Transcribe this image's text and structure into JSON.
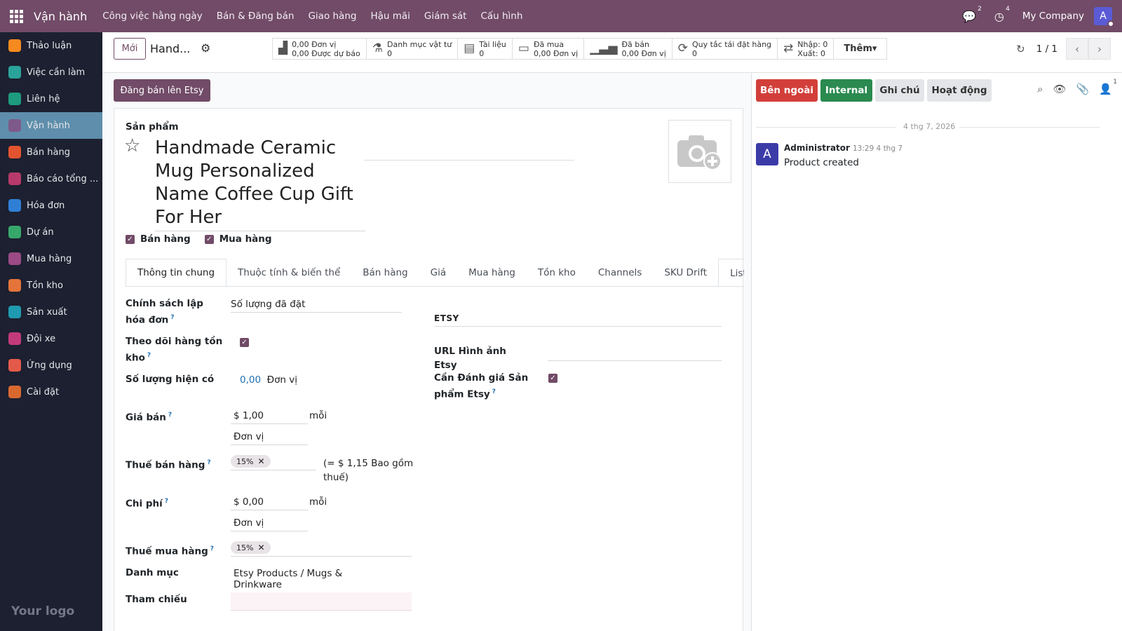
{
  "topnav": {
    "brand": "Vận hành",
    "menu": [
      "Công việc hằng ngày",
      "Bán & Đăng bán",
      "Giao hàng",
      "Hậu mãi",
      "Giám sát",
      "Cấu hình"
    ],
    "chat_count": "2",
    "activity_count": "4",
    "company": "My Company",
    "avatar_letter": "A"
  },
  "sidebar": {
    "items": [
      {
        "label": "Thảo luận",
        "color": "#f58a1f"
      },
      {
        "label": "Việc cần làm",
        "color": "#2aa39a"
      },
      {
        "label": "Liên hệ",
        "color": "#1e9b7f"
      },
      {
        "label": "Vận hành",
        "color": "#7e5a8a",
        "active": true
      },
      {
        "label": "Bán hàng",
        "color": "#e2542f"
      },
      {
        "label": "Báo cáo tổng ...",
        "color": "#b83a6a"
      },
      {
        "label": "Hóa đơn",
        "color": "#2f7fd6"
      },
      {
        "label": "Dự án",
        "color": "#37a86b"
      },
      {
        "label": "Mua hàng",
        "color": "#9b4a86"
      },
      {
        "label": "Tồn kho",
        "color": "#e4743a"
      },
      {
        "label": "Sản xuất",
        "color": "#1f9ab0"
      },
      {
        "label": "Đội xe",
        "color": "#c33a7a"
      },
      {
        "label": "Ứng dụng",
        "color": "#e45a4a"
      },
      {
        "label": "Cài đặt",
        "color": "#d9682f"
      }
    ],
    "logo": "Your logo"
  },
  "control": {
    "new_label": "Mới",
    "breadcrumb": "Hand...",
    "smart_buttons": [
      {
        "icon": "forecast-chart-icon",
        "line1": "0,00 Đơn vị",
        "line2": "0,00 Được dự báo"
      },
      {
        "icon": "flask-icon",
        "line1": "Danh mục vật tư",
        "line2": "0"
      },
      {
        "icon": "document-icon",
        "line1": "Tài liệu",
        "line2": "0"
      },
      {
        "icon": "credit-card-icon",
        "line1": "Đã mua",
        "line2": "0,00 Đơn vị"
      },
      {
        "icon": "bar-signal-icon",
        "line1": "Đã bán",
        "line2": "0,00 Đơn vị"
      },
      {
        "icon": "refresh-icon",
        "line1": "Quy tắc tái đặt hàng",
        "line2": "0"
      },
      {
        "icon": "exchange-icon",
        "line1": "Nhập: 0",
        "line2": "Xuất: 0"
      }
    ],
    "more_label": "Thêm",
    "pager": "1 / 1"
  },
  "form": {
    "etsy_button": "Đăng bán lên Etsy",
    "product_label": "Sản phẩm",
    "title": "Handmade Ceramic Mug Personalized Name Coffee Cup Gift For Her",
    "can_sell_label": "Bán hàng",
    "can_purchase_label": "Mua hàng",
    "tabs": [
      "Thông tin chung",
      "Thuộc tính & biến thể",
      "Bán hàng",
      "Giá",
      "Mua hàng",
      "Tồn kho",
      "Channels",
      "SKU Drift",
      "Listing T"
    ],
    "invoice_policy_label": "Chính sách lập hóa đơn",
    "invoice_policy_value": "Số lượng đã đặt",
    "track_inventory_label": "Theo dõi hàng tồn kho",
    "qty_on_hand_label": "Số lượng hiện có",
    "qty_on_hand_value": "0,00",
    "qty_unit": "Đơn vị",
    "sale_price_label": "Giá bán",
    "sale_price_value": "$ 1,00",
    "per_label": "mỗi",
    "sale_uom": "Đơn vị",
    "sales_tax_label": "Thuế bán hàng",
    "sales_tax_tag": "15%",
    "tax_included_note": "(= $ 1,15 Bao gồm thuế)",
    "cost_label": "Chi phí",
    "cost_value": "$ 0,00",
    "cost_per_label": "mỗi",
    "cost_uom": "Đơn vị",
    "purchase_tax_label": "Thuế mua hàng",
    "purchase_tax_tag": "15%",
    "category_label": "Danh mục",
    "category_value": "Etsy Products / Mugs & Drinkware",
    "reference_label": "Tham chiếu",
    "etsy_section": "ETSY",
    "etsy_image_url_label": "URL Hình ảnh Etsy",
    "etsy_review_label": "Cần Đánh giá Sản phẩm Etsy"
  },
  "chatter": {
    "buttons": [
      "Bên ngoài",
      "Internal",
      "Ghi chú",
      "Hoạt động"
    ],
    "follower_count": "1",
    "date": "4 thg 7, 2026",
    "author": "Administrator",
    "time": "13:29 4 thg 7",
    "avatar_letter": "A",
    "message": "Product created"
  }
}
